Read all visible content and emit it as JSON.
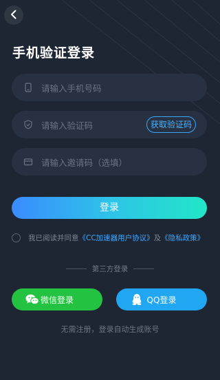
{
  "header": {
    "back_icon": "chevron-left-icon",
    "title": "手机验证登录"
  },
  "form": {
    "phone": {
      "placeholder": "请输入手机号码",
      "icon": "phone-icon"
    },
    "code": {
      "placeholder": "请输入验证码",
      "icon": "shield-icon",
      "get_code_label": "获取验证码"
    },
    "invite": {
      "placeholder": "请输入邀请码（选填）",
      "icon": "card-icon"
    },
    "login_label": "登录"
  },
  "agreement": {
    "prefix": "我已阅读并同意",
    "user_agreement": "《CC加速器用户协议》",
    "and": "及",
    "privacy_policy": "《隐私政策》"
  },
  "third_party": {
    "label": "第三方登录",
    "wechat_label": "微信登录",
    "qq_label": "QQ登录"
  },
  "footer": "无需注册，登录自动生成账号",
  "colors": {
    "background": "#1e2633",
    "field": "#283142",
    "accent_blue": "#3ea8ff",
    "gradient_start": "#3a8cff",
    "gradient_end": "#22e6c7",
    "wechat_green": "#23c341",
    "qq_blue": "#21a7f2"
  }
}
